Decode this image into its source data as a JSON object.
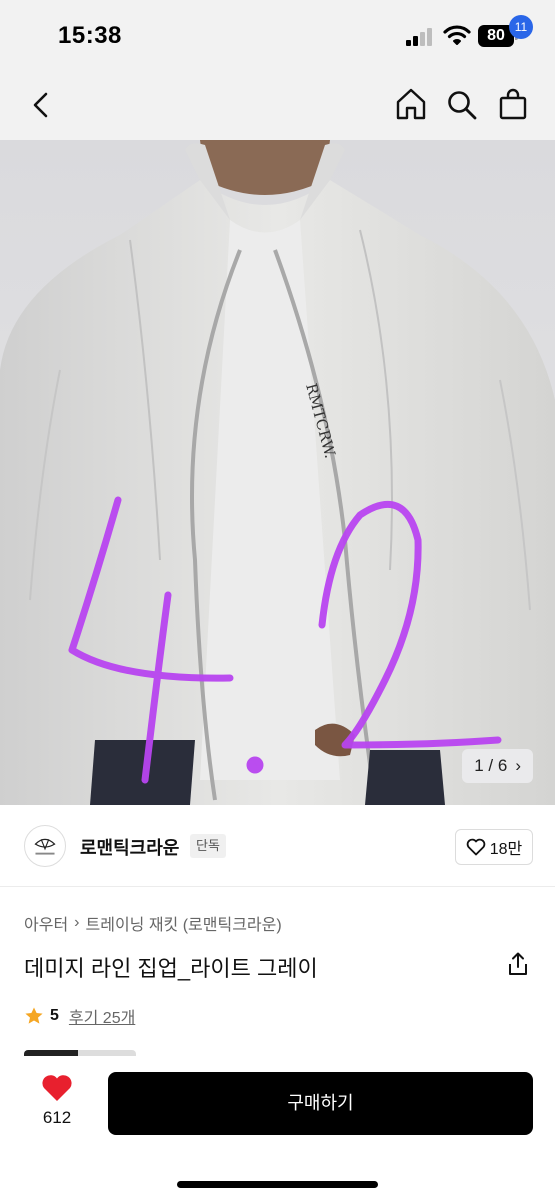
{
  "status_bar": {
    "time": "15:38",
    "battery": "80"
  },
  "nav": {
    "cart_count": "11"
  },
  "gallery": {
    "counter_current": "1",
    "counter_sep": "/",
    "counter_total": "6",
    "counter_arrow": "›",
    "logo_text": "RMTCRW.",
    "handwritten_note": "4.2"
  },
  "seller": {
    "name": "로맨틱크라운",
    "tag": "단독",
    "likes": "18만"
  },
  "product": {
    "breadcrumb": [
      "아우터",
      "트레이닝 재킷 (로맨틱크라운)"
    ],
    "breadcrumb_sep": "›",
    "title": "데미지 라인 집업_라이트 그레이",
    "rating": "5",
    "review_link": "후기 25개"
  },
  "bottom_bar": {
    "wish_count": "612",
    "buy_label": "구매하기"
  },
  "colors": {
    "accent_blue": "#2a66e8",
    "heart_red": "#e8202e",
    "star_orange": "#f5a623",
    "annotation_purple": "#b845f0"
  },
  "icons": [
    "back-arrow-icon",
    "home-icon",
    "search-icon",
    "shopping-bag-icon",
    "heart-outline-icon",
    "share-icon",
    "star-icon",
    "heart-filled-icon"
  ]
}
